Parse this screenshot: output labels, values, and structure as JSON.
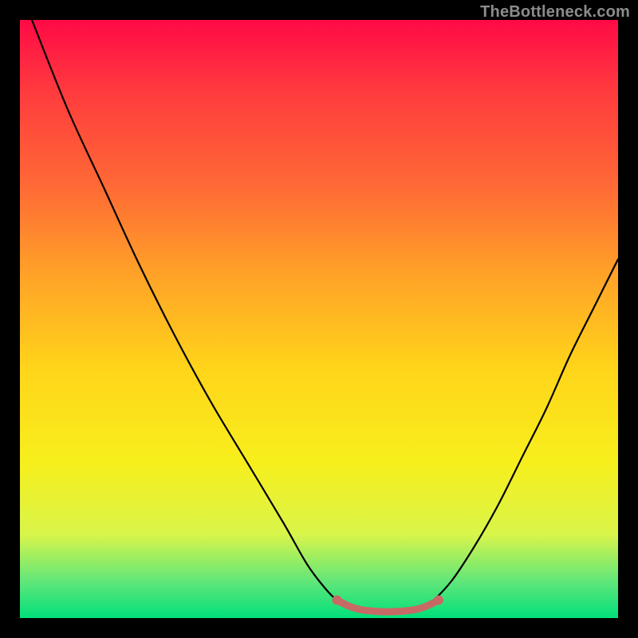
{
  "watermark": {
    "text": "TheBottleneck.com"
  },
  "chart_data": {
    "type": "line",
    "title": "",
    "xlabel": "",
    "ylabel": "",
    "xlim": [
      0,
      100
    ],
    "ylim": [
      0,
      100
    ],
    "grid": false,
    "legend": false,
    "series": [
      {
        "name": "left-arm",
        "x": [
          2,
          8,
          14,
          20,
          26,
          32,
          38,
          44,
          48,
          51,
          53,
          55
        ],
        "values": [
          100,
          85,
          72,
          59,
          47,
          36,
          26,
          16,
          9,
          5,
          3,
          2
        ]
      },
      {
        "name": "basin",
        "x": [
          55,
          57,
          60,
          63,
          66,
          68
        ],
        "values": [
          2,
          1.4,
          1.1,
          1.1,
          1.4,
          2
        ]
      },
      {
        "name": "right-arm",
        "x": [
          68,
          72,
          76,
          80,
          84,
          88,
          92,
          96,
          100
        ],
        "values": [
          2,
          6,
          12,
          19,
          27,
          35,
          44,
          52,
          60
        ]
      }
    ],
    "annotations": {
      "basin_highlight": {
        "color": "#c76a66",
        "x": [
          53,
          55,
          57,
          60,
          63,
          66,
          68,
          70
        ],
        "values": [
          3.0,
          2.0,
          1.4,
          1.1,
          1.1,
          1.4,
          2.0,
          3.0
        ]
      }
    },
    "background_gradient": {
      "top": "#ff0a46",
      "bottom": "#00e07a"
    }
  }
}
